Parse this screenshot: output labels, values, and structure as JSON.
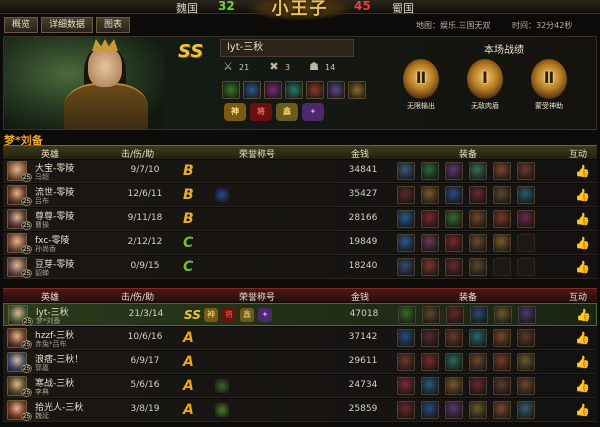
{
  "scoreboard": {
    "left_team": "魏国",
    "left_score": "32",
    "right_score": "45",
    "right_team": "蜀国",
    "emblem_text": "小王子"
  },
  "tabs": [
    {
      "label": "概览",
      "active": false
    },
    {
      "label": "详细数据",
      "active": false
    },
    {
      "label": "图表",
      "active": false
    }
  ],
  "info": {
    "map": "地图：娱乐.三国无双",
    "time": "时间：32分42秒"
  },
  "player": {
    "rank_badge": "SS",
    "name": "lyt-三秋",
    "kills": "21",
    "deaths": "3",
    "assists": "14",
    "kill_icon": "crossed-swords-icon",
    "death_icon": "skull-icon",
    "assist_icon": "helmet-icon",
    "pet_colors": [
      "#3a7a2a",
      "#2a5a8a",
      "#7a2a7a",
      "#2a7a6a",
      "#8a3a2a",
      "#5a4a8a",
      "#8a6a2a"
    ],
    "titles": [
      {
        "glyph": "神",
        "bg": "#7a5a10",
        "fg": "#f8e08a"
      },
      {
        "glyph": "将",
        "bg": "#6a1010",
        "fg": "#ff6a4a"
      },
      {
        "glyph": "鑫",
        "bg": "#6a5a20",
        "fg": "#f0d060"
      },
      {
        "glyph": "✦",
        "bg": "#4a2a6a",
        "fg": "#c8a0ff"
      }
    ]
  },
  "battle_record": {
    "title": "本场战绩",
    "medals": [
      {
        "numeral": "Ⅱ",
        "label": "无限输出"
      },
      {
        "numeral": "Ⅰ",
        "label": "无敌肉盾"
      },
      {
        "numeral": "Ⅱ",
        "label": "蒙受神助"
      }
    ]
  },
  "team_title": "梦*刘备",
  "headers": {
    "hero": "英雄",
    "kda": "击/伤/助",
    "honor": "荣誉称号",
    "gold": "金钱",
    "equip": "装备",
    "interact": "互动"
  },
  "team_wei": [
    {
      "player": "大宝-零陵",
      "hero": "马超",
      "level": "25",
      "kda": "9/7/10",
      "grade": "B",
      "honors": [],
      "gold": "34841",
      "avatar": "#8a5a3a",
      "equips": [
        "#3a5a7a",
        "#2a6a3a",
        "#5a3a6a",
        "#3a6a5a",
        "#7a4a2a",
        "#6a3a2a"
      ]
    },
    {
      "player": "流世-零陵",
      "hero": "吕布",
      "level": "25",
      "kda": "12/6/11",
      "grade": "B",
      "honors": [
        "#2a4a8a"
      ],
      "gold": "35427",
      "avatar": "#6a3a2a",
      "equips": [
        "#5a2a2a",
        "#7a5a2a",
        "#2a4a7a",
        "#6a2a2a",
        "#5a4a2a",
        "#2a5a6a"
      ]
    },
    {
      "player": "尊尊-零陵",
      "hero": "曹操",
      "level": "25",
      "kda": "9/11/18",
      "grade": "B",
      "honors": [],
      "gold": "28166",
      "avatar": "#5a3a3a",
      "equips": [
        "#2a5a8a",
        "#7a2a2a",
        "#3a6a2a",
        "#6a4a2a",
        "#7a3a2a",
        "#6a2a4a"
      ]
    },
    {
      "player": "fxc-零陵",
      "hero": "孙尚香",
      "level": "25",
      "kda": "2/12/12",
      "grade": "C",
      "honors": [],
      "gold": "19849",
      "avatar": "#7a4a3a",
      "equips": [
        "#2a5a8a",
        "#6a3a5a",
        "#7a2a2a",
        "#6a4a2a",
        "#7a5a2a",
        "empty"
      ]
    },
    {
      "player": "豆芽-零陵",
      "hero": "貂蝉",
      "level": "25",
      "kda": "0/9/15",
      "grade": "C",
      "honors": [],
      "gold": "18240",
      "avatar": "#6a4a4a",
      "equips": [
        "#3a4a6a",
        "#7a3a2a",
        "#6a2a2a",
        "#5a4a2a",
        "empty",
        "empty"
      ]
    }
  ],
  "team_shu": [
    {
      "player": "lyt-三秋",
      "hero": "梦*刘备",
      "level": "25",
      "kda": "21/3/14",
      "grade": "SS",
      "honors": [],
      "gold": "47018",
      "avatar": "#4a5a3a",
      "highlight": true,
      "equips": [
        "#3a6a2a",
        "#5a4a2a",
        "#6a2a2a",
        "#2a4a6a",
        "#6a5a2a",
        "#4a3a6a"
      ]
    },
    {
      "player": "hzzf-三秋",
      "hero": "赤兔*吕布",
      "level": "25",
      "kda": "10/6/16",
      "grade": "A",
      "honors": [],
      "gold": "37142",
      "avatar": "#6a3a2a",
      "equips": [
        "#2a4a7a",
        "#5a2a2a",
        "#6a3a2a",
        "#2a6a6a",
        "#7a4a2a",
        "#5a3a2a"
      ]
    },
    {
      "player": "浪痞-三秋！",
      "hero": "郭嘉",
      "level": "25",
      "kda": "6/9/17",
      "grade": "A",
      "honors": [],
      "gold": "29611",
      "avatar": "#3a4a6a",
      "equips": [
        "#6a3a2a",
        "#7a2a2a",
        "#2a6a5a",
        "#6a4a2a",
        "#7a3a2a",
        "#6a5a2a"
      ]
    },
    {
      "player": "寒战-三秋",
      "hero": "李典",
      "level": "25",
      "kda": "5/6/16",
      "grade": "A",
      "honors": [
        "#3a6a2a"
      ],
      "gold": "24734",
      "avatar": "#5a4a2a",
      "equips": [
        "#7a2a3a",
        "#2a5a7a",
        "#7a5a2a",
        "#6a2a2a",
        "#5a3a2a",
        "#6a4a2a"
      ]
    },
    {
      "player": "拾光人-三秋",
      "hero": "魏延",
      "level": "25",
      "kda": "3/8/19",
      "grade": "A",
      "honors": [
        "#4a7a2a"
      ],
      "gold": "25859",
      "avatar": "#7a3a2a",
      "equips": [
        "#6a2a2a",
        "#2a4a7a",
        "#5a3a6a",
        "#6a5a2a",
        "#7a4a2a",
        "#3a5a6a"
      ]
    }
  ]
}
